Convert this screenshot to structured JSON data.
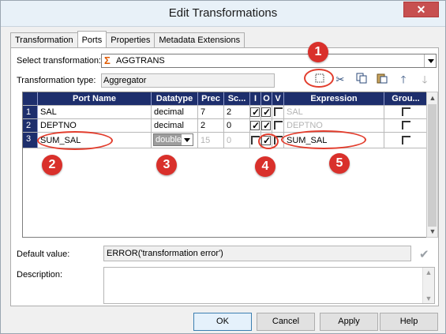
{
  "window": {
    "title": "Edit Transformations",
    "close_glyph": "✕"
  },
  "tabs": [
    {
      "label": "Transformation",
      "active": false
    },
    {
      "label": "Ports",
      "active": true
    },
    {
      "label": "Properties",
      "active": false
    },
    {
      "label": "Metadata Extensions",
      "active": false
    }
  ],
  "select_transformation": {
    "label": "Select transformation:",
    "value": "AGGTRANS",
    "icon": "sigma-icon"
  },
  "transformation_type": {
    "label": "Transformation type:",
    "value": "Aggregator"
  },
  "toolbar": {
    "icons": [
      "new-port-icon",
      "cut-icon",
      "copy-icon",
      "paste-icon",
      "move-up-icon",
      "move-down-icon"
    ]
  },
  "grid": {
    "headers": [
      "Port Name",
      "Datatype",
      "Prec",
      "Sc...",
      "I",
      "O",
      "V",
      "Expression",
      "Grou..."
    ],
    "rows": [
      {
        "num": "1",
        "port_name": "SAL",
        "datatype": "decimal",
        "prec": "7",
        "scale": "2",
        "input": true,
        "output": true,
        "variable": false,
        "expression": "SAL",
        "group_by": false
      },
      {
        "num": "2",
        "port_name": "DEPTNO",
        "datatype": "decimal",
        "prec": "2",
        "scale": "0",
        "input": true,
        "output": true,
        "variable": false,
        "expression": "DEPTNO",
        "group_by": false
      },
      {
        "num": "3",
        "port_name": "SUM_SAL",
        "datatype": "double",
        "prec": "15",
        "scale": "0",
        "input": false,
        "output": true,
        "variable": false,
        "expression": "SUM_SAL",
        "group_by": false
      }
    ]
  },
  "default_value": {
    "label": "Default value:",
    "value": "ERROR('transformation error')"
  },
  "description": {
    "label": "Description:",
    "value": ""
  },
  "buttons": {
    "ok": "OK",
    "cancel": "Cancel",
    "apply": "Apply",
    "help": "Help"
  },
  "annotations": {
    "color": "#d9302b",
    "markers": [
      "1",
      "2",
      "3",
      "4",
      "5"
    ]
  }
}
